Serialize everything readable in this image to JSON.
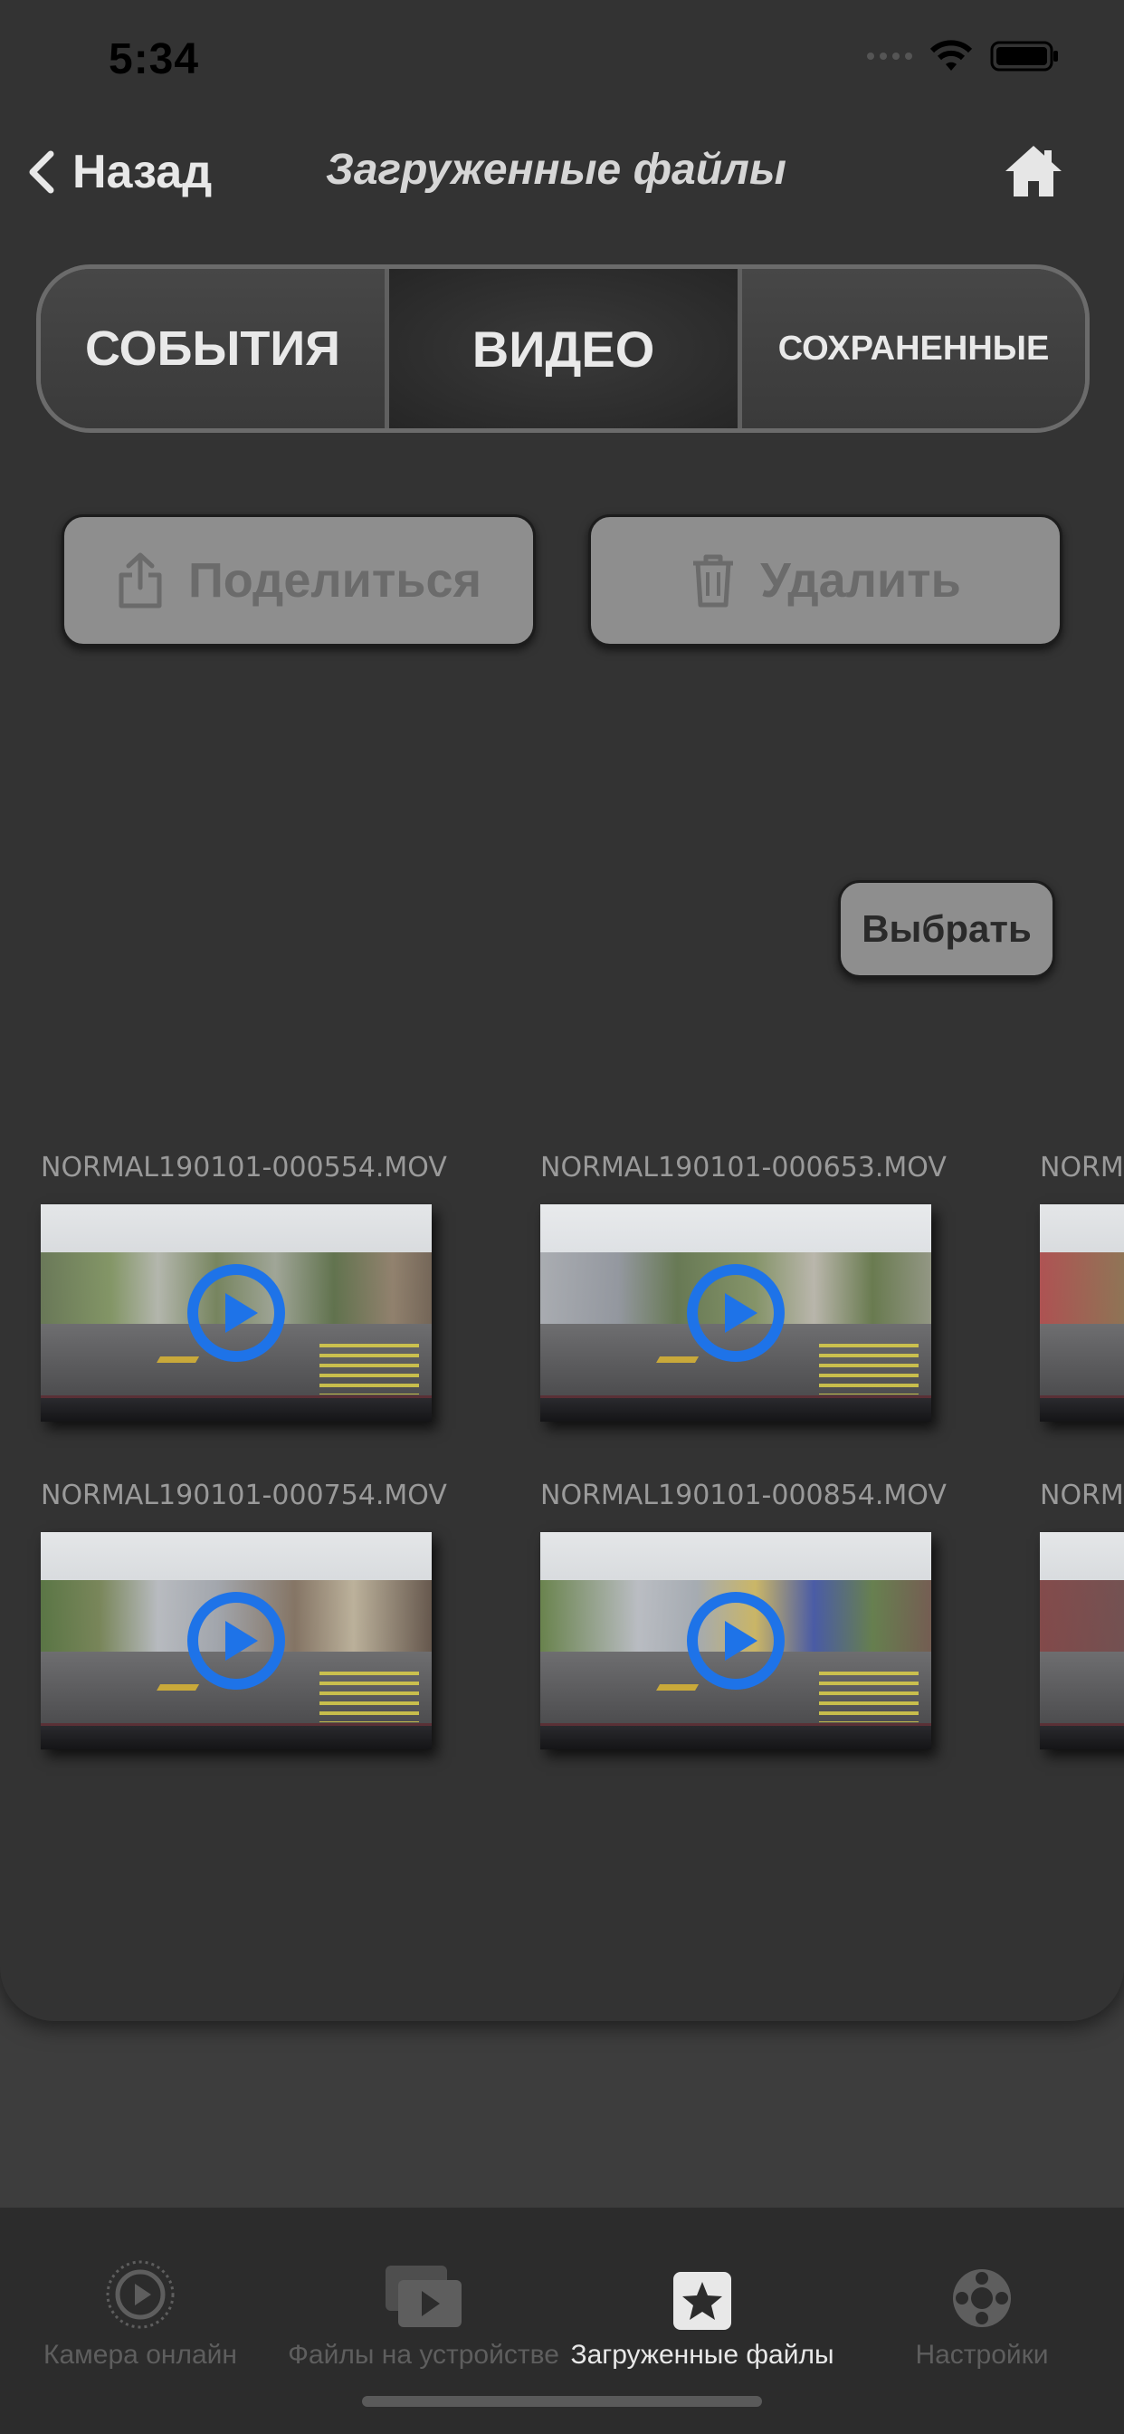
{
  "status": {
    "time": "5:34"
  },
  "nav": {
    "back_label": "Назад",
    "title": "Загруженные файлы"
  },
  "segments": [
    {
      "label": "СОБЫТИЯ",
      "selected": false
    },
    {
      "label": "ВИДЕО",
      "selected": true
    },
    {
      "label": "СОХРАНЕННЫЕ",
      "selected": false
    }
  ],
  "actions": {
    "share_label": "Поделиться",
    "delete_label": "Удалить",
    "select_label": "Выбрать"
  },
  "files": [
    {
      "name": "NORMAL190101-000554.MOV"
    },
    {
      "name": "NORMAL190101-000653.MOV"
    },
    {
      "name": "NORMAL190101-000754.MOV"
    },
    {
      "name": "NORMAL190101-000854.MOV"
    }
  ],
  "partial_files": [
    {
      "name": "NORM"
    },
    {
      "name": "NORM"
    }
  ],
  "tabbar": {
    "items": [
      {
        "label": "Камера онлайн",
        "icon": "play-circle-icon",
        "active": false
      },
      {
        "label": "Файлы на устройстве",
        "icon": "video-files-icon",
        "active": false
      },
      {
        "label": "Загруженные файлы",
        "icon": "star-icon",
        "active": true
      },
      {
        "label": "Настройки",
        "icon": "settings-wheel-icon",
        "active": false
      }
    ]
  },
  "colors": {
    "accent_play": "#1e73e8",
    "background": "#333333",
    "button": "#8e8e8e"
  }
}
